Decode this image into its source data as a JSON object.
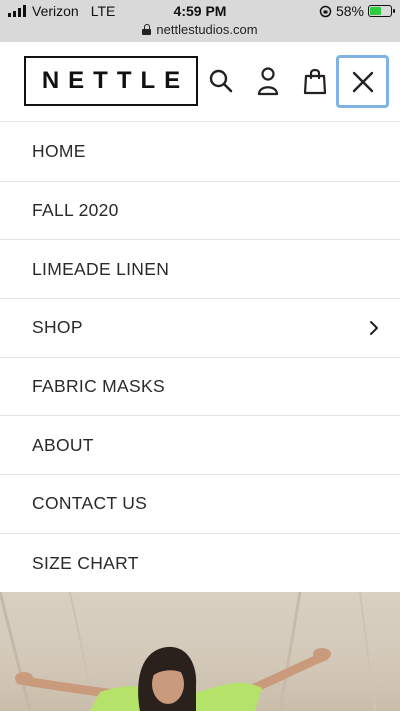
{
  "status_bar": {
    "carrier": "Verizon",
    "network": "LTE",
    "time": "4:59 PM",
    "battery_percent": "58%",
    "battery_level": 0.58,
    "url": "nettlestudios.com"
  },
  "header": {
    "logo_text": "NETTLE",
    "icons": [
      "search-icon",
      "account-icon",
      "cart-icon",
      "close-icon"
    ]
  },
  "menu": {
    "items": [
      {
        "label": "HOME"
      },
      {
        "label": "FALL 2020"
      },
      {
        "label": "LIMEADE LINEN"
      },
      {
        "label": "SHOP",
        "has_submenu": true
      },
      {
        "label": "FABRIC MASKS"
      },
      {
        "label": "ABOUT"
      },
      {
        "label": "CONTACT US"
      },
      {
        "label": "SIZE CHART"
      }
    ]
  },
  "colors": {
    "status_bar_bg": "#d9d9d9",
    "close_button_outline": "#7fb3e3",
    "divider": "#e3e3e3",
    "text": "#2a2a2a"
  }
}
